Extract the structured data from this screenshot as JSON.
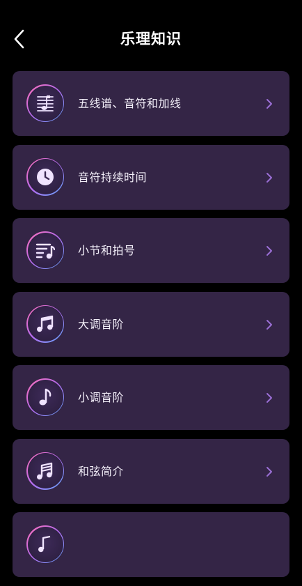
{
  "header": {
    "title": "乐理知识",
    "back_icon": "back-arrow-icon"
  },
  "colors": {
    "background": "#000000",
    "card": "#342546",
    "chevron": "#9b6fd6",
    "icon_glyph": "#f0e3ff",
    "icon_ring": [
      "#ff6fb5",
      "#5fa8ff"
    ]
  },
  "items": [
    {
      "label": "五线谱、音符和加线",
      "icon": "staff-note-icon"
    },
    {
      "label": "音符持续时间",
      "icon": "clock-icon"
    },
    {
      "label": "小节和拍号",
      "icon": "playlist-music-icon"
    },
    {
      "label": "大调音阶",
      "icon": "double-note-icon"
    },
    {
      "label": "小调音阶",
      "icon": "single-note-icon"
    },
    {
      "label": "和弦简介",
      "icon": "chord-notes-icon"
    },
    {
      "label": "",
      "icon": "partial-note-icon"
    }
  ]
}
